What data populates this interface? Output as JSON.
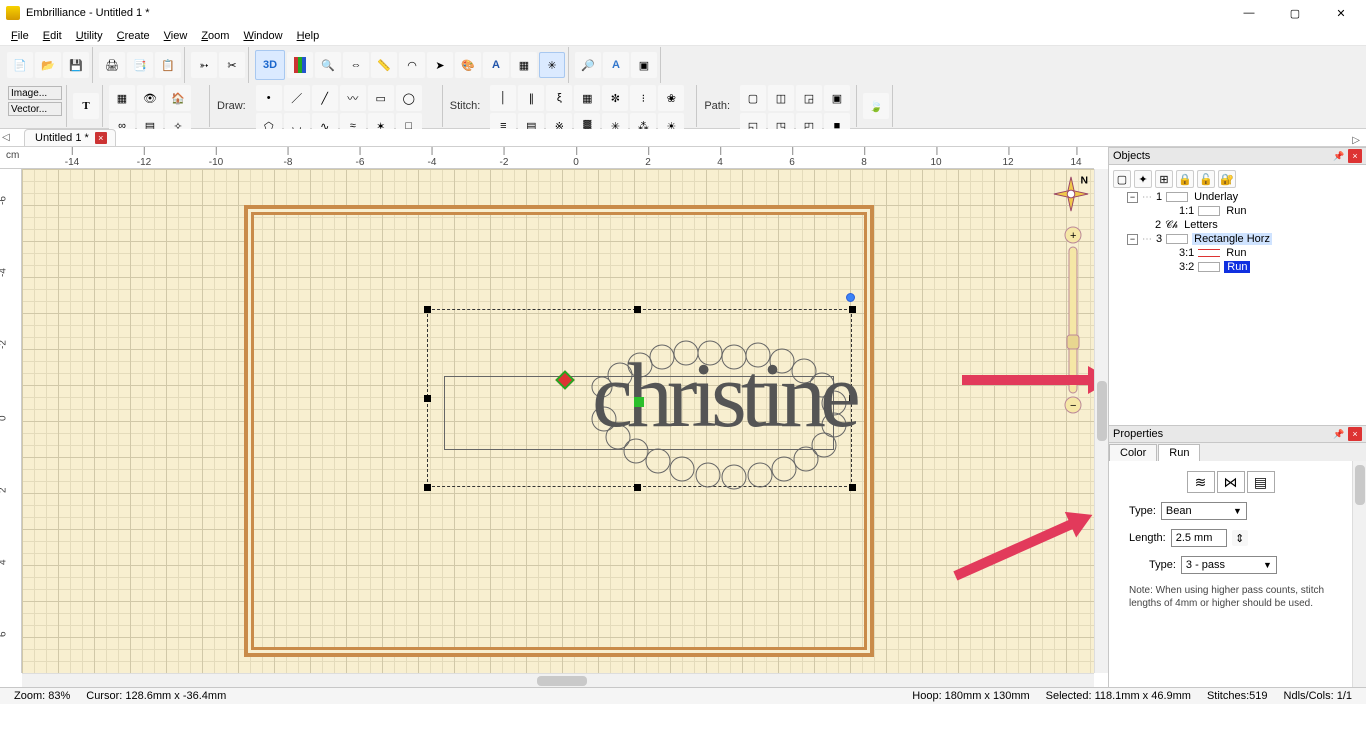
{
  "title": "Embrilliance -  Untitled 1 *",
  "menubar": [
    "File",
    "Edit",
    "Utility",
    "Create",
    "View",
    "Zoom",
    "Window",
    "Help"
  ],
  "side_buttons": {
    "image": "Image...",
    "vector": "Vector..."
  },
  "toolbar_labels": {
    "draw": "Draw:",
    "stitch": "Stitch:",
    "path": "Path:",
    "three_d": "3D"
  },
  "doc_tab": {
    "label": "Untitled 1 *"
  },
  "ruler": {
    "unit": "cm",
    "h_ticks": [
      "-14",
      "-12",
      "-10",
      "-8",
      "-6",
      "-4",
      "-2",
      "0",
      "2",
      "4",
      "6",
      "8",
      "10",
      "12",
      "14"
    ],
    "v_ticks": [
      "-6",
      "-4",
      "-2",
      "0",
      "2",
      "4",
      "6"
    ]
  },
  "canvas_text": "christine",
  "compass_label": "N",
  "objects_panel": {
    "title": "Objects",
    "tree": {
      "n1": {
        "idx": "1",
        "label": "Underlay"
      },
      "n1_1": {
        "idx": "1:1",
        "label": "Run"
      },
      "n2": {
        "idx": "2",
        "label": "Letters"
      },
      "n3": {
        "idx": "3",
        "label": "Rectangle Horz"
      },
      "n3_1": {
        "idx": "3:1",
        "label": "Run"
      },
      "n3_2": {
        "idx": "3:2",
        "label": "Run"
      }
    }
  },
  "properties_panel": {
    "title": "Properties",
    "tabs": {
      "color": "Color",
      "run": "Run"
    },
    "type_label": "Type:",
    "type_value": "Bean",
    "length_label": "Length:",
    "length_value": "2.5 mm",
    "type2_label": "Type:",
    "type2_value": "3 - pass",
    "note": "Note: When using higher pass counts, stitch lengths of 4mm or higher should be used."
  },
  "statusbar": {
    "zoom": "Zoom: 83%",
    "cursor": "Cursor: 128.6mm x -36.4mm",
    "hoop": "Hoop: 180mm x 130mm",
    "selected": "Selected: 118.1mm x 46.9mm",
    "stitches": "Stitches:519",
    "ndls": "Ndls/Cols: 1/1"
  }
}
